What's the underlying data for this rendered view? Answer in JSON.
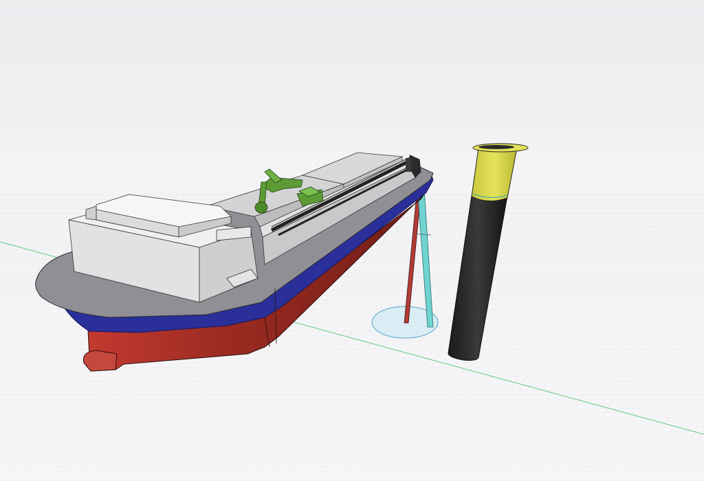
{
  "scene": {
    "description_visible_text": "",
    "colors": {
      "background": "#f4f4f6",
      "grid_line": "#d8d8de",
      "axis_x": "#7ccf8f",
      "hull_red": "#9c2b22",
      "hull_blue": "#2a2f9a",
      "deck_grey": "#8f8f95",
      "superstructure": "#e6e6e6",
      "crane_green": "#5d9b35",
      "pipe_dark": "#222222",
      "riser_cyan": "#6fd3d0",
      "riser_red": "#b23b35",
      "pile_black": "#262626",
      "pile_yellow": "#d7d64b",
      "footprint_fill": "#c9e7f2"
    },
    "objects": [
      {
        "name": "vessel-hull",
        "icon": "ship-icon"
      },
      {
        "name": "deckhouse",
        "icon": "block-icon"
      },
      {
        "name": "cargo-hold-fore",
        "icon": "box-icon"
      },
      {
        "name": "cargo-hold-aft",
        "icon": "box-icon"
      },
      {
        "name": "excavator-crane",
        "icon": "crane-icon"
      },
      {
        "name": "discharge-pipeline",
        "icon": "pipe-icon"
      },
      {
        "name": "riser-pipe-red",
        "icon": "pipe-icon"
      },
      {
        "name": "riser-pipe-cyan",
        "icon": "pipe-icon"
      },
      {
        "name": "seabed-footprint",
        "icon": "circle-icon"
      },
      {
        "name": "monopile",
        "icon": "cylinder-icon"
      }
    ]
  }
}
